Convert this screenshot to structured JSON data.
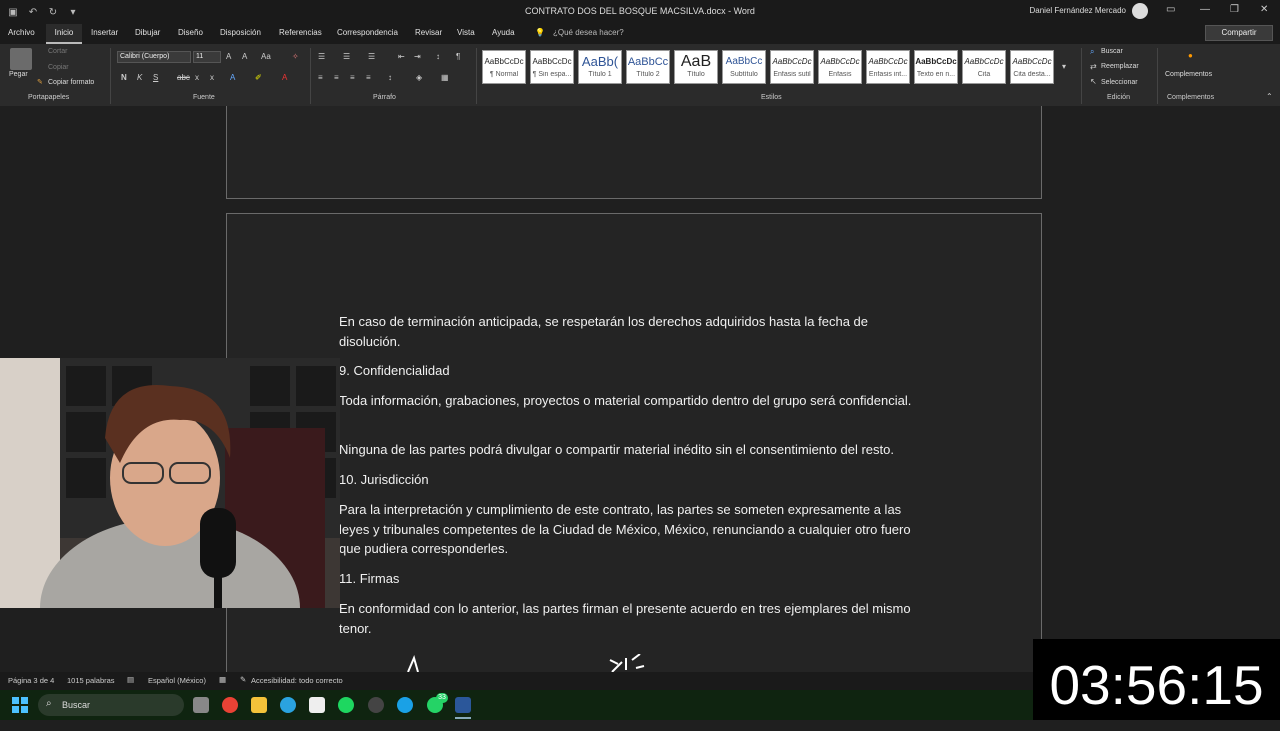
{
  "titlebar": {
    "doc_title": "CONTRATO DOS DEL BOSQUE MACSILVA.docx  -  Word",
    "user_name": "Daniel Fernández Mercado"
  },
  "tabs": [
    "Archivo",
    "Inicio",
    "Insertar",
    "Dibujar",
    "Diseño",
    "Disposición",
    "Referencias",
    "Correspondencia",
    "Revisar",
    "Vista",
    "Ayuda"
  ],
  "tell_me": "¿Qué desea hacer?",
  "share": "Compartir",
  "ribbon": {
    "clipboard": {
      "paste": "Pegar",
      "cut": "Cortar",
      "copy": "Copiar",
      "format_painter": "Copiar formato",
      "label": "Portapapeles"
    },
    "font": {
      "name": "Calibri (Cuerpo)",
      "size": "11",
      "label": "Fuente"
    },
    "paragraph": {
      "label": "Párrafo"
    },
    "styles": {
      "label": "Estilos",
      "items": [
        {
          "sample": "AaBbCcDc",
          "name": "¶ Normal"
        },
        {
          "sample": "AaBbCcDc",
          "name": "¶ Sin espa..."
        },
        {
          "sample": "AaBb(",
          "name": "Título 1"
        },
        {
          "sample": "AaBbCc",
          "name": "Título 2"
        },
        {
          "sample": "AaB",
          "name": "Título"
        },
        {
          "sample": "AaBbCc",
          "name": "Subtítulo"
        },
        {
          "sample": "AaBbCcDc",
          "name": "Énfasis sutil"
        },
        {
          "sample": "AaBbCcDc",
          "name": "Énfasis"
        },
        {
          "sample": "AaBbCcDc",
          "name": "Énfasis int..."
        },
        {
          "sample": "AaBbCcDc",
          "name": "Texto en n..."
        },
        {
          "sample": "AaBbCcDc",
          "name": "Cita"
        },
        {
          "sample": "AaBbCcDc",
          "name": "Cita desta..."
        }
      ]
    },
    "editing": {
      "find": "Buscar",
      "replace": "Reemplazar",
      "select": "Seleccionar",
      "label": "Edición"
    },
    "addins": {
      "label_btn": "Complementos",
      "label": "Complementos"
    }
  },
  "document": {
    "paragraphs": [
      "En caso de terminación anticipada, se respetarán los derechos adquiridos hasta la fecha de disolución.",
      "9. Confidencialidad",
      "Toda información, grabaciones, proyectos o material compartido dentro del grupo será confidencial.",
      "Ninguna de las partes podrá divulgar o compartir material inédito sin el consentimiento del resto.",
      "10. Jurisdicción",
      "Para la interpretación y cumplimiento de este contrato, las partes se someten expresamente a las leyes y tribunales competentes de la Ciudad de México, México, renunciando a cualquier otro fuero que pudiera corresponderles.",
      "11. Firmas",
      "En conformidad con lo anterior, las partes firman el presente acuerdo en tres ejemplares del mismo tenor."
    ]
  },
  "statusbar": {
    "page": "Página 3 de 4",
    "words": "1015 palabras",
    "language": "Español (México)",
    "accessibility": "Accesibilidad: todo correcto"
  },
  "taskbar": {
    "search": "Buscar",
    "whatsapp_badge": "33"
  },
  "timer": "03:56:15",
  "colors": {
    "bg": "#1f1f1f",
    "ribbon": "#2b2b2b",
    "taskbar": "#0f2410",
    "page_border": "#6a6a6a"
  }
}
